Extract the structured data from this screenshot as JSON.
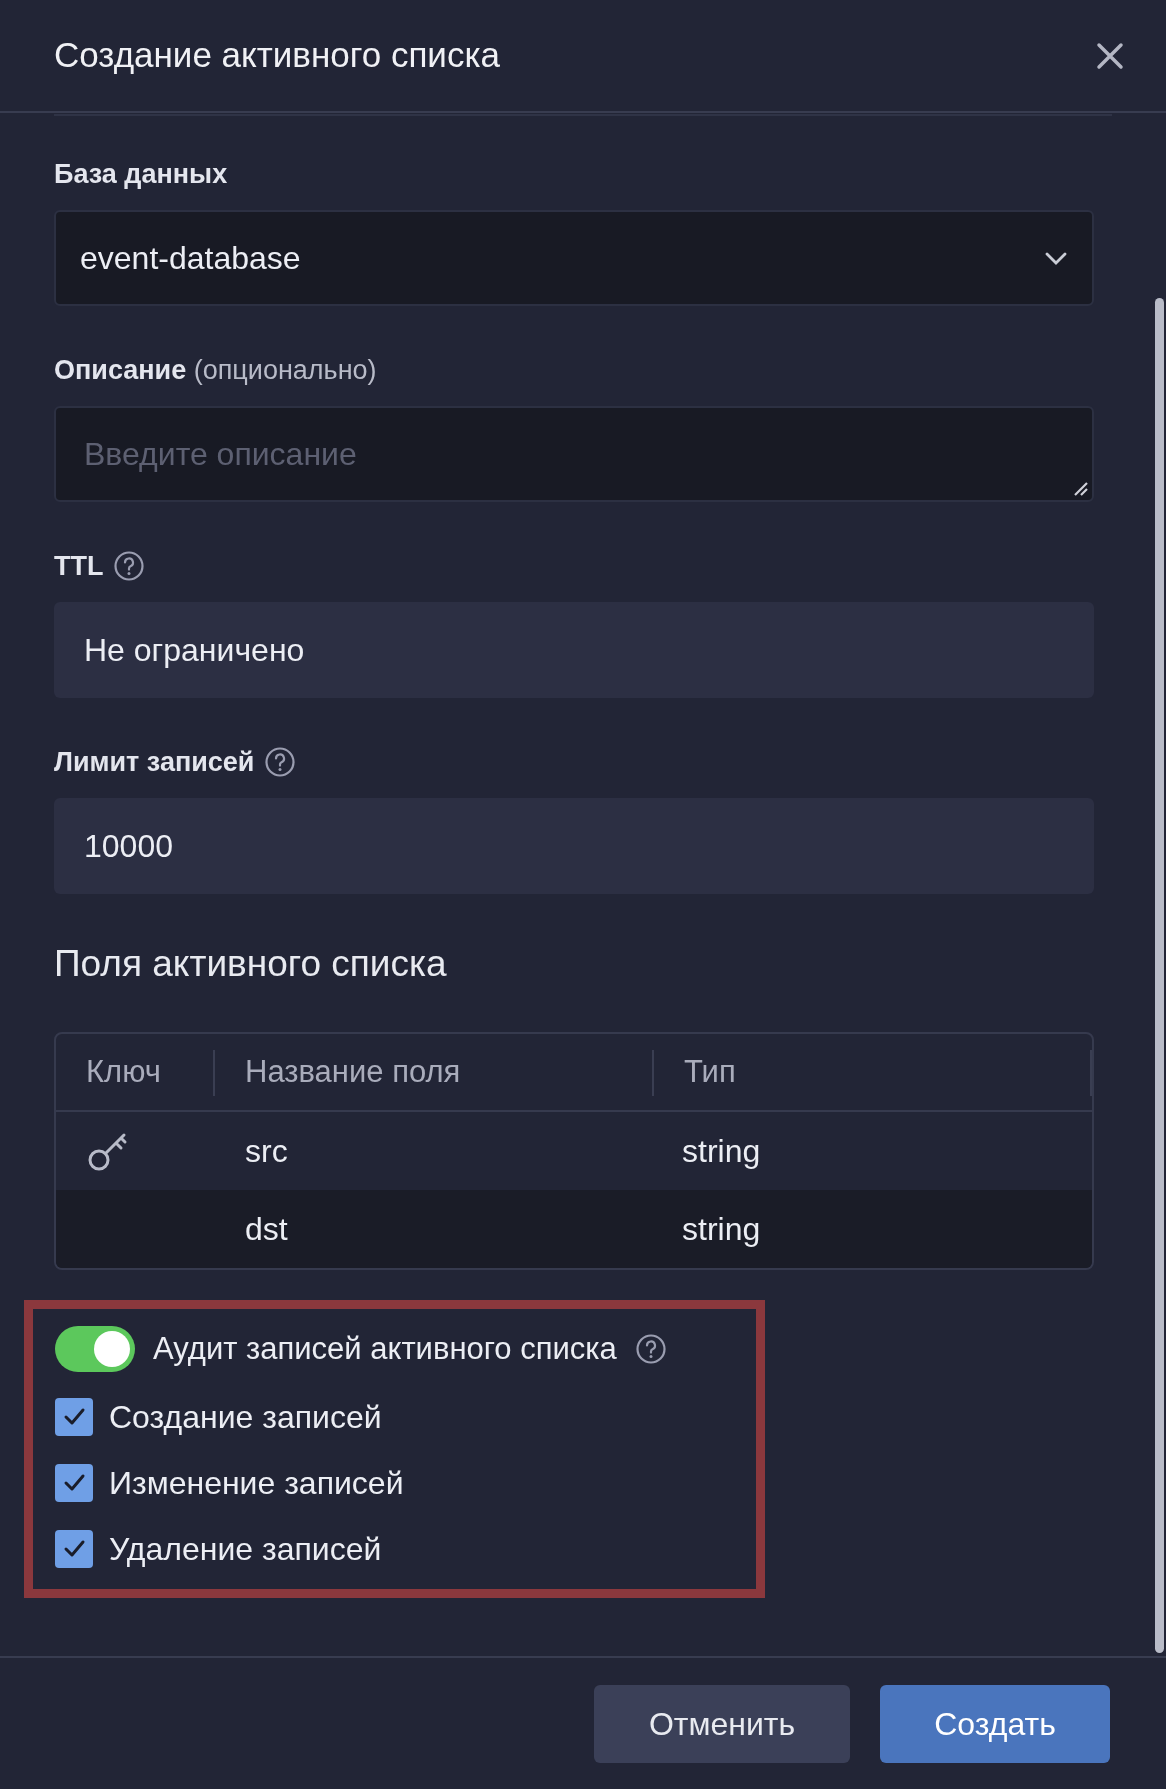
{
  "dialog": {
    "title": "Создание активного списка"
  },
  "fields": [
    {
      "kind": "select",
      "label": "База данных",
      "value": "event-database",
      "help": false
    },
    {
      "kind": "textarea",
      "label": "Описание",
      "label_note": "(опционально)",
      "placeholder": "Введите описание",
      "help": false
    },
    {
      "kind": "text",
      "label": "TTL",
      "value": "Не ограничено",
      "help": true
    },
    {
      "kind": "text",
      "label": "Лимит записей",
      "value": "10000",
      "help": true
    }
  ],
  "section_title": "Поля активного списка",
  "table": {
    "columns": [
      "Ключ",
      "Название поля",
      "Тип"
    ],
    "rows": [
      {
        "key": true,
        "name": "src",
        "type": "string"
      },
      {
        "key": false,
        "name": "dst",
        "type": "string"
      }
    ]
  },
  "audit": {
    "highlighted": true,
    "label": "Аудит записей активного списка",
    "on": true,
    "help": true,
    "options": [
      {
        "label": "Создание записей",
        "checked": true
      },
      {
        "label": "Изменение записей",
        "checked": true
      },
      {
        "label": "Удаление записей",
        "checked": true
      }
    ]
  },
  "buttons": [
    {
      "label": "Отменить",
      "kind": "secondary"
    },
    {
      "label": "Создать",
      "kind": "primary"
    }
  ]
}
